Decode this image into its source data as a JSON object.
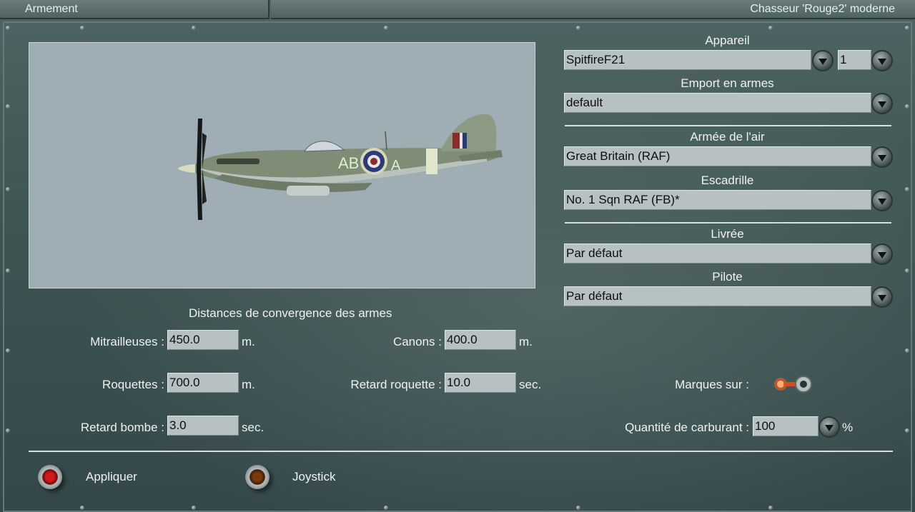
{
  "header": {
    "left_title": "Armement",
    "right_title": "Chasseur  'Rouge2' moderne"
  },
  "preview": {
    "aircraft_code_left": "AB",
    "aircraft_code_right": "A"
  },
  "convergence": {
    "title": "Distances de convergence des armes",
    "mitrailleuses_label": "Mitrailleuses :",
    "mitrailleuses_value": "450.0",
    "mitrailleuses_unit": "m.",
    "canons_label": "Canons :",
    "canons_value": "400.0",
    "canons_unit": "m.",
    "roquettes_label": "Roquettes :",
    "roquettes_value": "700.0",
    "roquettes_unit": "m.",
    "retard_roquette_label": "Retard roquette :",
    "retard_roquette_value": "10.0",
    "retard_roquette_unit": "sec.",
    "retard_bombe_label": "Retard bombe :",
    "retard_bombe_value": "3.0",
    "retard_bombe_unit": "sec."
  },
  "settings": {
    "appareil_label": "Appareil",
    "appareil_value": "SpitfireF21",
    "appareil_count": "1",
    "emport_label": "Emport en armes",
    "emport_value": "default",
    "armee_label": "Armée de l'air",
    "armee_value": "Great Britain (RAF)",
    "escadrille_label": "Escadrille",
    "escadrille_value": "No. 1 Sqn RAF (FB)*",
    "livree_label": "Livrée",
    "livree_value": "Par défaut",
    "pilote_label": "Pilote",
    "pilote_value": "Par défaut",
    "marques_label": "Marques sur :",
    "carburant_label": "Quantité de carburant :",
    "carburant_value": "100",
    "carburant_unit": "%"
  },
  "footer": {
    "appliquer_label": "Appliquer",
    "joystick_label": "Joystick"
  },
  "colors": {
    "panel": "#3f5654",
    "field": "#b7c1c1",
    "preview_bg": "#9fadb5",
    "knob_red": "#d21818"
  }
}
